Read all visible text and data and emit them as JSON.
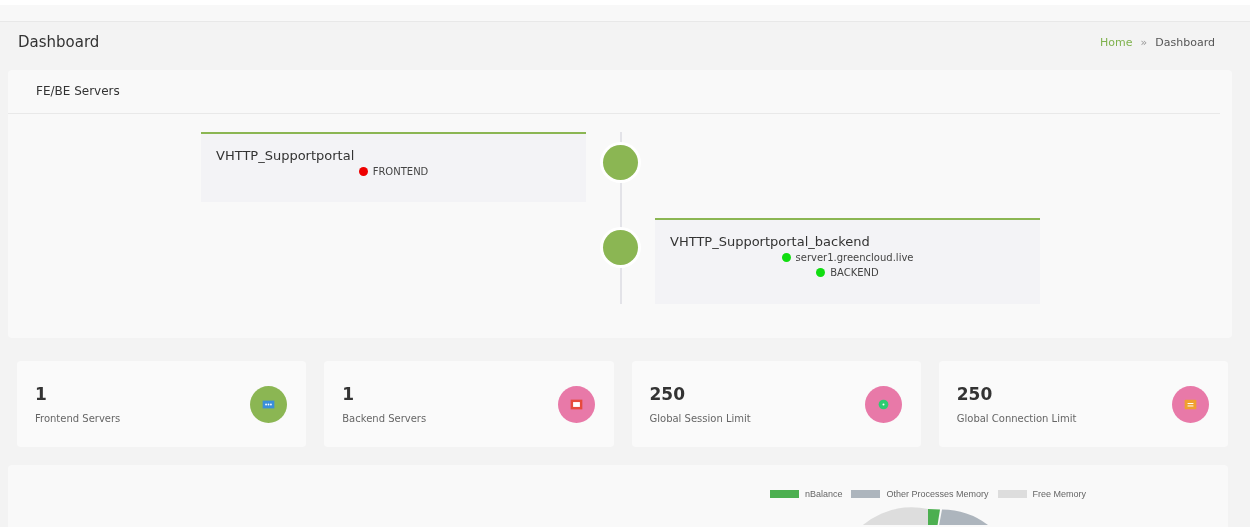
{
  "header": {
    "title": "Dashboard",
    "breadcrumb": [
      {
        "label": "Home",
        "kind": "link"
      },
      {
        "label": "»",
        "kind": "separator"
      },
      {
        "label": "Dashboard",
        "kind": "current"
      }
    ]
  },
  "servers_panel": {
    "title": "FE/BE Servers",
    "nodes": [
      {
        "name": "VHTTP_Supportportal",
        "lines": [
          {
            "text": "FRONTEND",
            "color": "#ee0000"
          }
        ]
      },
      {
        "name": "VHTTP_Supportportal_backend",
        "lines": [
          {
            "text": "server1.greencloud.live",
            "color": "#11dd11"
          },
          {
            "text": "BACKEND",
            "color": "#11dd11"
          }
        ]
      }
    ]
  },
  "stats": [
    {
      "value": "1",
      "label": "Frontend Servers",
      "kind": "chat",
      "color": "#8bb653"
    },
    {
      "value": "1",
      "label": "Backend Servers",
      "kind": "screen",
      "color": "#e879a8"
    },
    {
      "value": "250",
      "label": "Global Session Limit",
      "kind": "dot",
      "color": "#e879a8"
    },
    {
      "value": "250",
      "label": "Global Connection Limit",
      "kind": "message",
      "color": "#e879a8"
    }
  ],
  "memory_panel": {
    "legend": [
      {
        "label": "nBalance",
        "color": "#4caf50"
      },
      {
        "label": "Other Processes Memory",
        "color": "#adb5bd"
      },
      {
        "label": "Free Memory",
        "color": "#dddddd"
      }
    ]
  }
}
